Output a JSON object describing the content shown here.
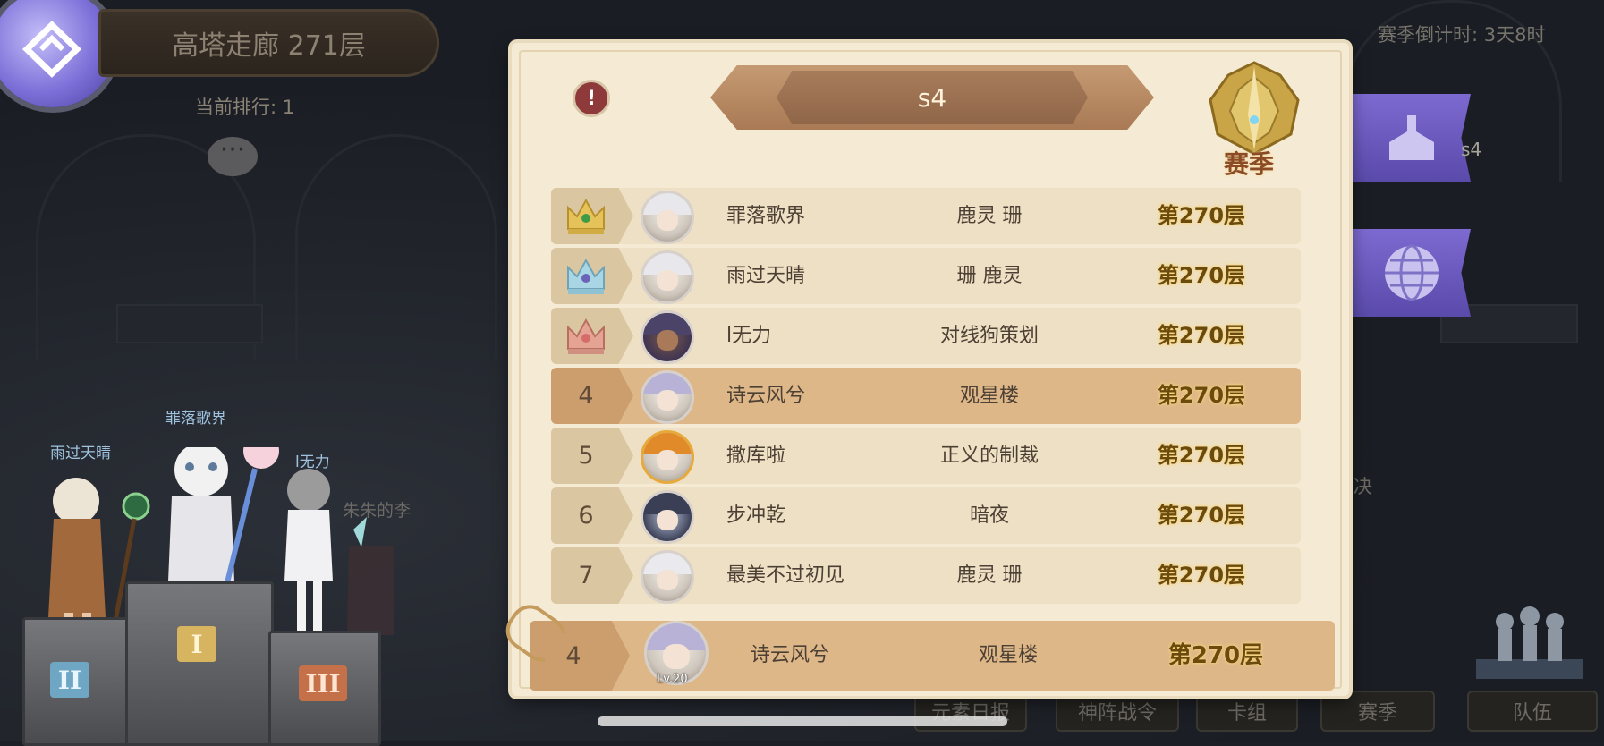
{
  "header": {
    "tower_title": "高塔走廊 271层",
    "current_rank_label": "当前排行: 1",
    "chat_glyph": "···"
  },
  "characters": [
    {
      "name": "雨过天晴"
    },
    {
      "name": "罪落歌界"
    },
    {
      "name": "l无力"
    },
    {
      "name": "朱朱的李"
    }
  ],
  "podium": {
    "first": "I",
    "second": "II",
    "third": "III"
  },
  "right_side": {
    "season_countdown": "赛季倒计时: 3天8时",
    "season_small": "s4",
    "partial_char": "决"
  },
  "bottom_tabs": [
    "元素日报",
    "神阵战令",
    "卡组",
    "赛季",
    "队伍"
  ],
  "panel": {
    "alert_glyph": "!",
    "season_title": "s4",
    "emblem_label": "赛季",
    "rows": [
      {
        "rank": "",
        "crown": "gold",
        "name": "罪落歌界",
        "guild": "鹿灵 珊",
        "floor": "第270层",
        "highlight": false
      },
      {
        "rank": "",
        "crown": "blue",
        "name": "雨过天晴",
        "guild": "珊 鹿灵",
        "floor": "第270层",
        "highlight": false
      },
      {
        "rank": "",
        "crown": "bronze",
        "name": "l无力",
        "guild": "对线狗策划",
        "floor": "第270层",
        "highlight": false
      },
      {
        "rank": "4",
        "crown": "",
        "name": "诗云风兮",
        "guild": "观星楼",
        "floor": "第270层",
        "highlight": true
      },
      {
        "rank": "5",
        "crown": "",
        "name": "撒库啦",
        "guild": "正义的制裁",
        "floor": "第270层",
        "highlight": false
      },
      {
        "rank": "6",
        "crown": "",
        "name": "步冲乾",
        "guild": "暗夜",
        "floor": "第270层",
        "highlight": false
      },
      {
        "rank": "7",
        "crown": "",
        "name": "最美不过初见",
        "guild": "鹿灵 珊",
        "floor": "第270层",
        "highlight": false
      }
    ],
    "my_row": {
      "rank": "4",
      "level": "Lv.20",
      "name": "诗云风兮",
      "guild": "观星楼",
      "floor": "第270层"
    }
  },
  "colors": {
    "panel_bg": "#f5ead3",
    "row_bg": "#eee0c4",
    "highlight_row": "#deb789",
    "floor_text": "#6b4a0e",
    "side_flag": "#6d5bc2"
  }
}
